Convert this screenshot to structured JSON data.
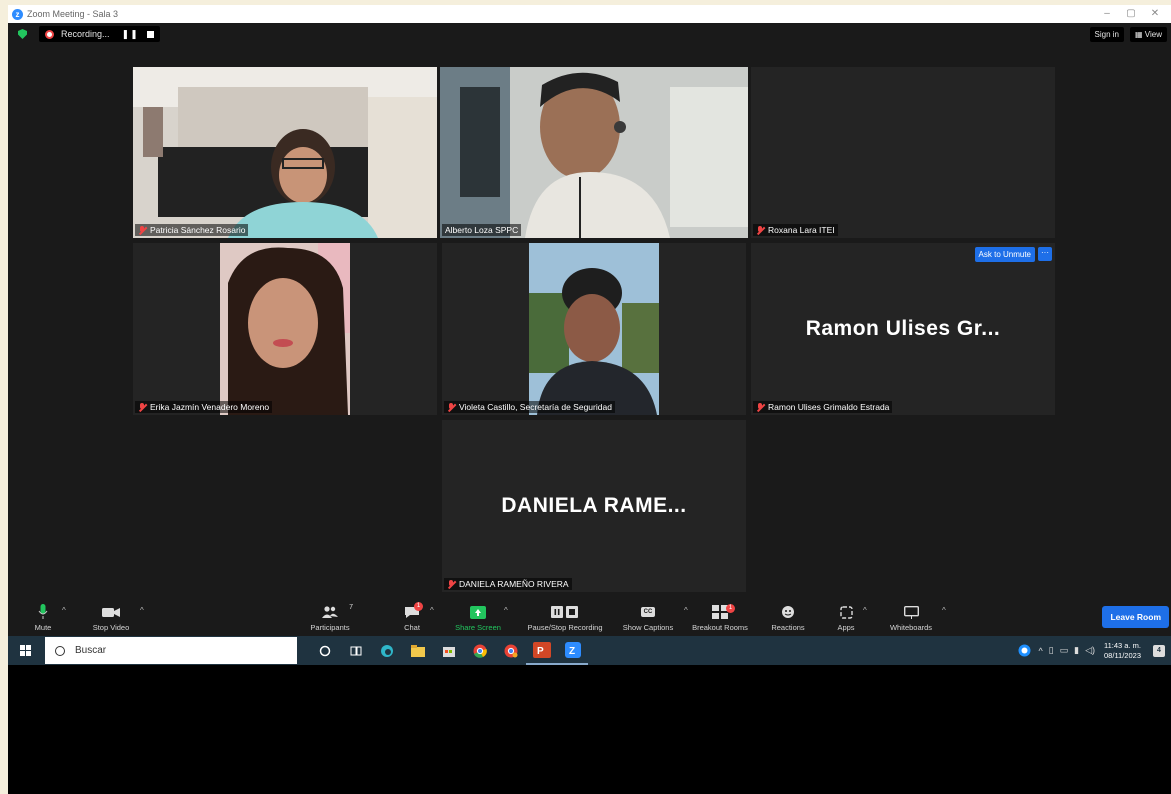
{
  "window": {
    "title": "Zoom Meeting - Sala 3",
    "controls": [
      "–",
      "▢",
      "✕"
    ]
  },
  "topbar": {
    "recording_label": "Recording...",
    "sign_in": "Sign in",
    "view": "View"
  },
  "tiles": {
    "patricia": {
      "name": "Patricia Sánchez Rosario"
    },
    "alberto": {
      "name": "Alberto Loza SPPC"
    },
    "roxana": {
      "name": "Roxana Lara ITEI"
    },
    "erika": {
      "name": "Erika Jazmín Venadero Moreno"
    },
    "violeta": {
      "name": "Violeta Castillo, Secretaría de Seguridad"
    },
    "ramon": {
      "name": "Ramon Ulises Grimaldo Estrada",
      "display": "Ramon Ulises Gr...",
      "ask_unmute": "Ask to Unmute",
      "more": "···"
    },
    "daniela": {
      "name": "DANIELA RAMEÑO RIVERA",
      "display": "DANIELA RAME..."
    }
  },
  "toolbar": {
    "mute": "Mute",
    "stop_video": "Stop Video",
    "participants": "Participants",
    "participants_count": "7",
    "chat": "Chat",
    "chat_badge": "1",
    "share_screen": "Share Screen",
    "pause_recording": "Pause/Stop Recording",
    "show_captions": "Show Captions",
    "captions_icon": "CC",
    "breakout_rooms": "Breakout Rooms",
    "breakout_badge": "1",
    "reactions": "Reactions",
    "apps": "Apps",
    "whiteboards": "Whiteboards",
    "leave": "Leave Room"
  },
  "taskbar": {
    "search_placeholder": "Buscar",
    "time": "11:43 a. m.",
    "date": "08/11/2023",
    "notifications": "4"
  },
  "colors": {
    "zoom_blue": "#2d8cff",
    "leave_blue": "#1e6fe8",
    "active_speaker": "#d4d66a",
    "muted_red": "#ef4444",
    "share_green": "#22c55e"
  }
}
